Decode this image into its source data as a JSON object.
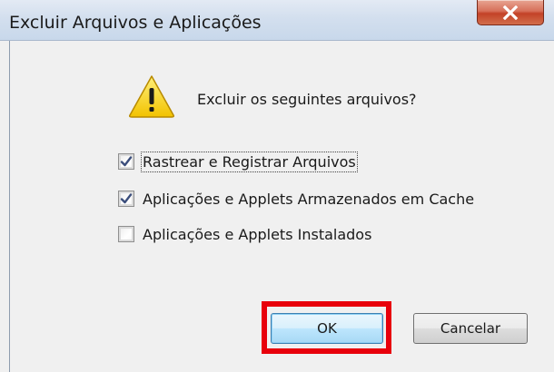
{
  "window": {
    "title": "Excluir Arquivos e Aplicações",
    "close_icon": "close-x-icon"
  },
  "dialog": {
    "icon": "warning-icon",
    "question": "Excluir os seguintes arquivos?",
    "options": [
      {
        "label": "Rastrear e Registrar Arquivos",
        "checked": true
      },
      {
        "label": "Aplicações e Applets Armazenados em Cache",
        "checked": true
      },
      {
        "label": "Aplicações e Applets Instalados",
        "checked": false
      }
    ],
    "buttons": {
      "ok_label": "OK",
      "cancel_label": "Cancelar"
    }
  },
  "annotation": {
    "highlight_color": "#e8000b",
    "highlight_target": "ok-button"
  },
  "colors": {
    "accent_checkmark": "#3b4e7c",
    "warning_yellow": "#f7d417"
  }
}
